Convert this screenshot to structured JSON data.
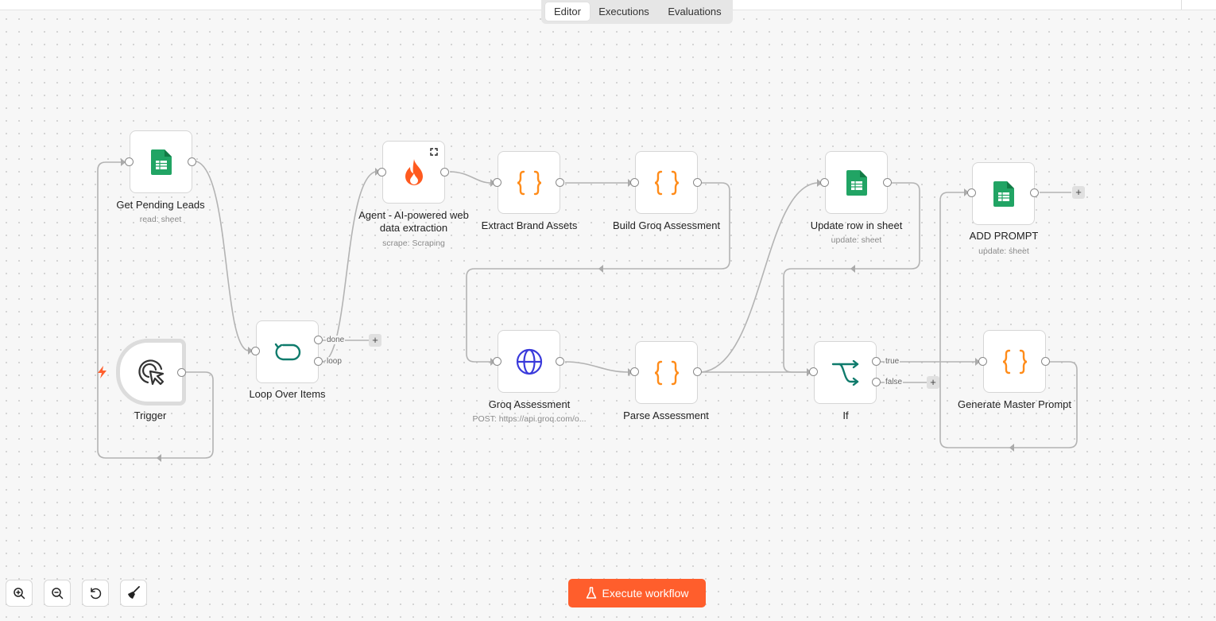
{
  "tabs": [
    "Editor",
    "Executions",
    "Evaluations"
  ],
  "active_tab": "Editor",
  "nodes": {
    "get_pending_leads": {
      "label": "Get Pending Leads",
      "sub": "read: sheet"
    },
    "trigger": {
      "label": "Trigger"
    },
    "loop": {
      "label": "Loop Over Items",
      "out1": "done",
      "out2": "loop"
    },
    "agent": {
      "label": "Agent - AI-powered web data extraction",
      "sub": "scrape: Scraping"
    },
    "extract": {
      "label": "Extract Brand Assets"
    },
    "build": {
      "label": "Build Groq Assessment"
    },
    "groq": {
      "label": "Groq Assessment",
      "sub": "POST: https://api.groq.com/o..."
    },
    "parse": {
      "label": "Parse Assessment"
    },
    "update": {
      "label": "Update row in sheet",
      "sub": "update: sheet"
    },
    "if": {
      "label": "If",
      "out1": "true",
      "out2": "false"
    },
    "add_prompt": {
      "label": "ADD PROMPT",
      "sub": "update: sheet"
    },
    "generate": {
      "label": "Generate Master Prompt"
    }
  },
  "plus_label": "+",
  "execute_label": "Execute workflow",
  "colors": {
    "accent": "#ff5e2c",
    "sheets": "#21a464",
    "code": "#ff8c1a",
    "loop": "#0f7b6c",
    "http": "#3a3adb",
    "fire": "#ff5a1f"
  },
  "icons": [
    "sheets-icon",
    "pointer-click-icon",
    "loop-icon",
    "fire-icon",
    "code-braces-icon",
    "globe-icon",
    "branch-icon",
    "zoom-in-icon",
    "zoom-out-icon",
    "undo-icon",
    "broom-icon",
    "flask-icon",
    "bolt-icon"
  ]
}
